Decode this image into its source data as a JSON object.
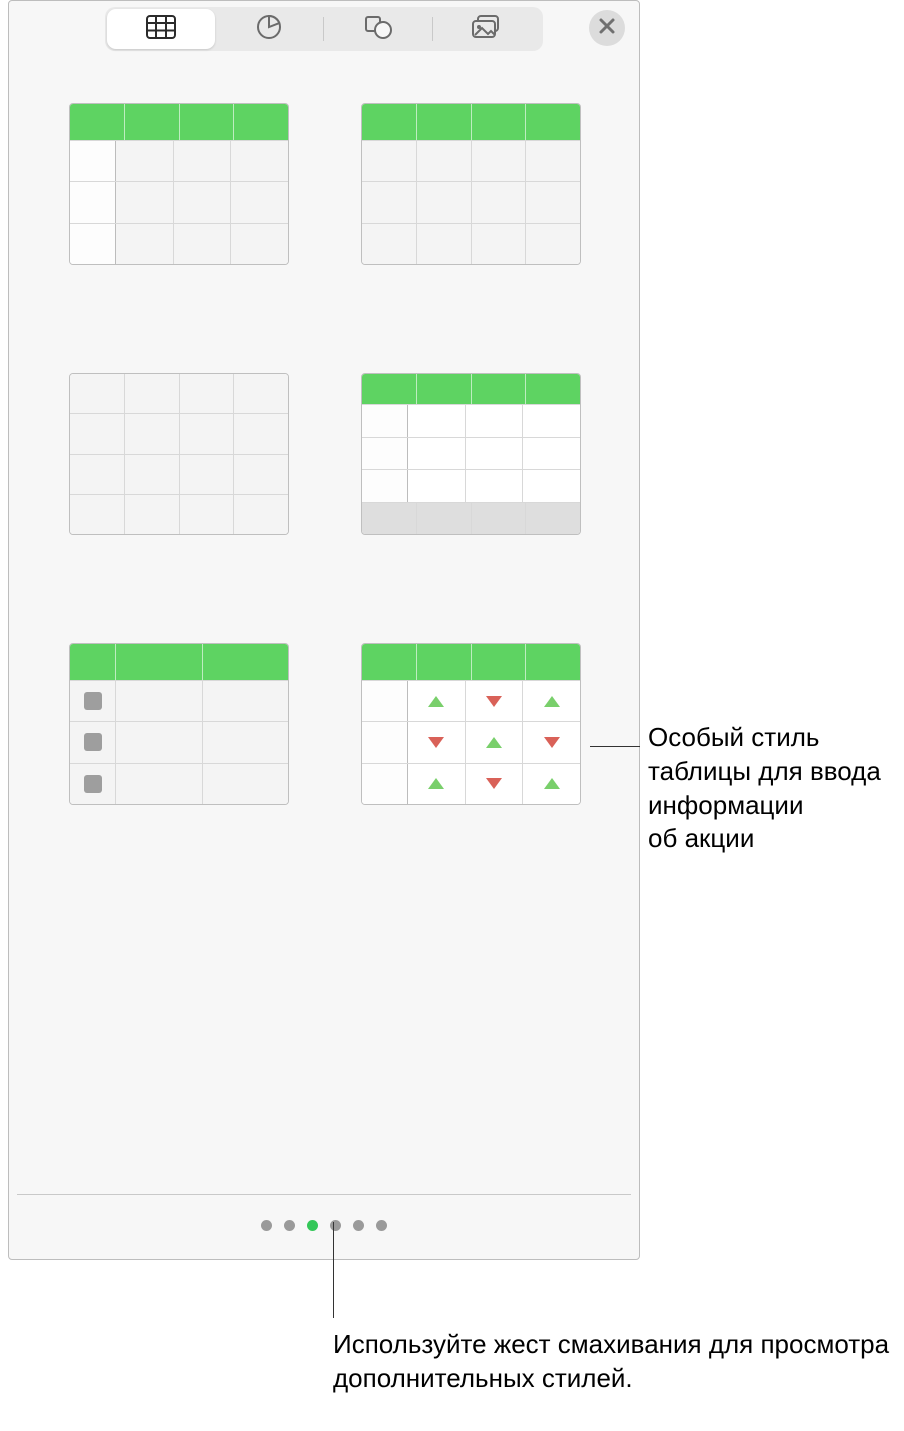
{
  "toolbar": {
    "tabs": [
      {
        "name": "table-tab",
        "icon": "table-icon",
        "active": true
      },
      {
        "name": "chart-tab",
        "icon": "pie-chart-icon",
        "active": false
      },
      {
        "name": "shape-tab",
        "icon": "shapes-icon",
        "active": false
      },
      {
        "name": "media-tab",
        "icon": "media-icon",
        "active": false
      }
    ],
    "close": "close"
  },
  "colors": {
    "header_green": "#5ed362",
    "accent_green": "#34c759",
    "tri_up": "#79cf6b",
    "tri_down": "#d96158"
  },
  "table_styles": [
    {
      "id": "style-green-header-firstcol",
      "cols": 4,
      "header": "green",
      "body_rows": 3,
      "first_col_divider": true
    },
    {
      "id": "style-green-header-plain",
      "cols": 4,
      "header": "green",
      "body_rows": 3
    },
    {
      "id": "style-plain-no-header",
      "cols": 4,
      "header": "none",
      "body_rows": 3
    },
    {
      "id": "style-green-header-footer",
      "cols": 4,
      "header": "green",
      "body_rows": 3,
      "white_body": true,
      "first_col_divider": true,
      "footer_row": true
    },
    {
      "id": "style-green-header-checkbox",
      "cols": 3,
      "header": "green",
      "body_rows": 3,
      "checkbox_first_col": true
    },
    {
      "id": "style-green-header-stock",
      "cols": 4,
      "header": "green",
      "body_rows": 3,
      "first_col_divider": true,
      "stock_arrows": [
        [
          "",
          "up",
          "down",
          "up"
        ],
        [
          "",
          "down",
          "up",
          "down"
        ],
        [
          "",
          "up",
          "down",
          "up"
        ]
      ],
      "white_body": true
    }
  ],
  "pager": {
    "count": 6,
    "active_index": 2
  },
  "callouts": {
    "stock_style": "Особый стиль таблицы для ввода информации об акции",
    "swipe_hint": "Используйте жест смахивания для просмотра дополнительных стилей."
  }
}
